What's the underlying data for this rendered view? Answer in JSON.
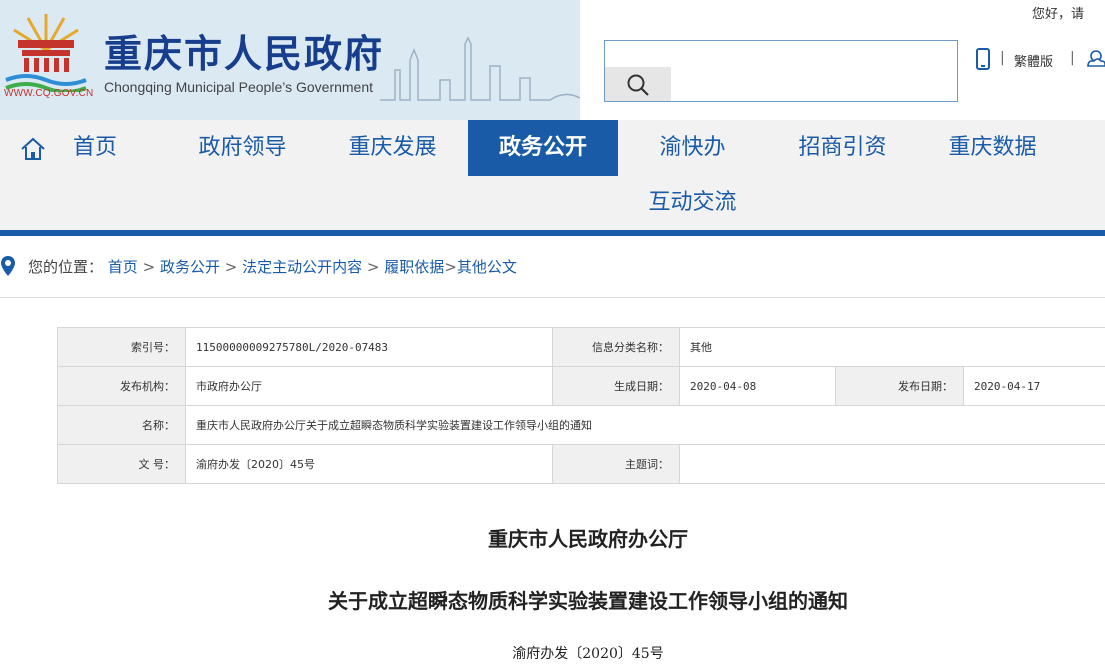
{
  "header": {
    "site_title": "重庆市人民政府",
    "site_subtitle": "Chongqing Municipal People’s Government",
    "site_url": "WWW.CQ.GOV.CN",
    "greeting": "您好，请",
    "search_placeholder": "",
    "separator": "|",
    "traditional_label": "繁體版",
    "colors": {
      "banner_bg": "#dbe9f3",
      "title": "#173e8c",
      "url": "#c4342c"
    }
  },
  "nav": {
    "items": [
      {
        "label": "首页"
      },
      {
        "label": "政府领导"
      },
      {
        "label": "重庆发展"
      },
      {
        "label": "政务公开",
        "active": true
      },
      {
        "label": "渝快办"
      },
      {
        "label": "招商引资"
      },
      {
        "label": "重庆数据"
      },
      {
        "label": "互动交流"
      }
    ],
    "colors": {
      "accent": "#1a5ba8",
      "bg": "#f2f2f2"
    }
  },
  "breadcrumb": {
    "prefix": "您的位置：",
    "items": [
      "首页",
      "政务公开",
      "法定主动公开内容",
      "履职依据",
      "其他公文"
    ],
    "sep": ">"
  },
  "info": {
    "index_label": "索引号：",
    "index_value": "11500000009275780L/2020-07483",
    "category_label": "信息分类名称：",
    "category_value": "其他",
    "publisher_label": "发布机构：",
    "publisher_value": "市政府办公厅",
    "created_label": "生成日期：",
    "created_value": "2020-04-08",
    "published_label": "发布日期：",
    "published_value": "2020-04-17",
    "name_label": "名称：",
    "name_value": "重庆市人民政府办公厅关于成立超瞬态物质科学实验装置建设工作领导小组的通知",
    "docno_label": "文 号：",
    "docno_value": "渝府办发〔2020〕45号",
    "subject_label": "主题词：",
    "subject_value": ""
  },
  "document": {
    "org": "重庆市人民政府办公厅",
    "title": "关于成立超瞬态物质科学实验装置建设工作领导小组的通知",
    "number": "渝府办发〔2020〕45号"
  }
}
